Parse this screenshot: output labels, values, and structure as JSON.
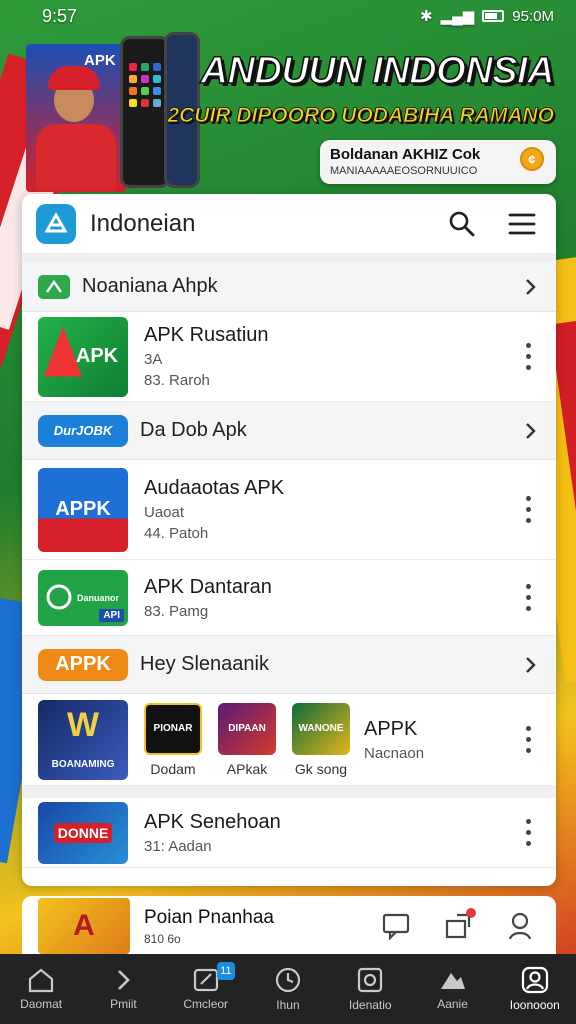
{
  "status_bar": {
    "time": "9:57",
    "right": "95:0M"
  },
  "banner": {
    "apk_tag": "APK",
    "title": "ANDUUN INDONSIA",
    "subtitle": "2CUIR DIPOORO UODABIHA RAMANO",
    "card_title": "Boldanan AKHIZ Cok",
    "card_sub": "MANIAAAAAEOSORNUUICO"
  },
  "header": {
    "title": "Indoneian"
  },
  "sections": [
    {
      "label": "Noaniana Ahpk"
    },
    {
      "label": "Da Dob Apk",
      "pill": "DurJOBK"
    },
    {
      "label": "Hey Slenaanik",
      "pill": "APPK"
    }
  ],
  "apps": [
    {
      "name": "APK Rusatiun",
      "meta1": "3A",
      "meta2": "83. Raroh",
      "icon_text": "APK"
    },
    {
      "name": "Audaaotas APK",
      "meta1": "Uaoat",
      "meta2": "44. Patoh",
      "icon_text": "APPK"
    },
    {
      "name": "APK Dantaran",
      "meta1": "83. Pamg",
      "icon_text": "Danuanor",
      "icon_tag": "API"
    }
  ],
  "games": {
    "thumb_text": "BOANAMING",
    "items": [
      {
        "label": "Dodam",
        "text": "PIONAR"
      },
      {
        "label": "APkak",
        "text": "DIPAAN"
      },
      {
        "label": "Gk song",
        "text": "WANONE"
      }
    ],
    "title": "APPK",
    "meta": "Nacnaon"
  },
  "last_app": {
    "name": "APK Senehoan",
    "meta": "31: Aadan",
    "icon_text": "DONNE"
  },
  "sub_bar": {
    "title": "Poian Pnanhaa",
    "meta": "810 6o"
  },
  "nav": [
    {
      "label": "Daomat"
    },
    {
      "label": "Pmiit"
    },
    {
      "label": "Cmcleor",
      "badge": "11"
    },
    {
      "label": "Ihun"
    },
    {
      "label": "Idenatio"
    },
    {
      "label": "Aanie"
    },
    {
      "label": "Ioonooon"
    }
  ],
  "colors": {
    "accent": "#1e9ad6",
    "green": "#2ea84a",
    "red": "#d52029",
    "yellow": "#f3c21c"
  }
}
